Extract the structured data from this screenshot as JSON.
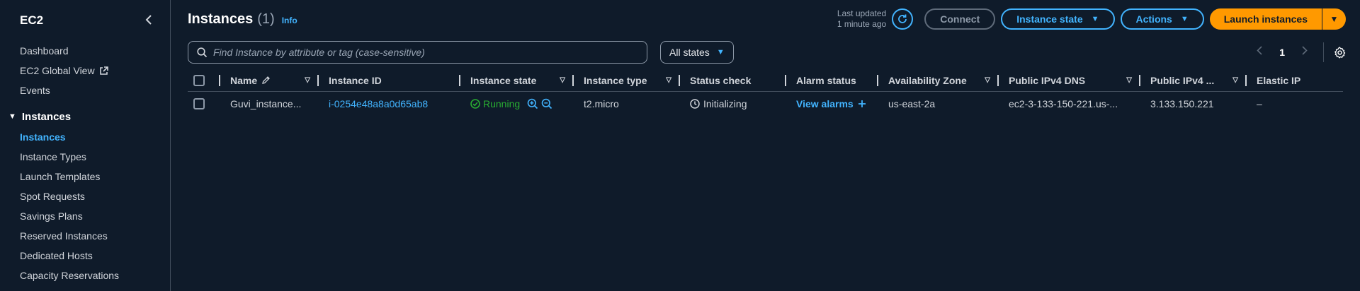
{
  "sidebar": {
    "title": "EC2",
    "items_top": [
      {
        "label": "Dashboard"
      },
      {
        "label": "EC2 Global View"
      },
      {
        "label": "Events"
      }
    ],
    "section": "Instances",
    "items_instances": [
      {
        "label": "Instances"
      },
      {
        "label": "Instance Types"
      },
      {
        "label": "Launch Templates"
      },
      {
        "label": "Spot Requests"
      },
      {
        "label": "Savings Plans"
      },
      {
        "label": "Reserved Instances"
      },
      {
        "label": "Dedicated Hosts"
      },
      {
        "label": "Capacity Reservations"
      }
    ]
  },
  "header": {
    "title": "Instances",
    "count": "(1)",
    "info": "Info",
    "last_updated_line1": "Last updated",
    "last_updated_line2": "1 minute ago",
    "connect": "Connect",
    "instance_state": "Instance state",
    "actions": "Actions",
    "launch": "Launch instances"
  },
  "filter": {
    "search_placeholder": "Find Instance by attribute or tag (case-sensitive)",
    "states_value": "All states",
    "page": "1"
  },
  "table": {
    "columns": {
      "name": "Name",
      "id": "Instance ID",
      "state": "Instance state",
      "type": "Instance type",
      "status": "Status check",
      "alarm": "Alarm status",
      "az": "Availability Zone",
      "dns": "Public IPv4 DNS",
      "ip4": "Public IPv4 ...",
      "eip": "Elastic IP"
    },
    "rows": [
      {
        "name": "Guvi_instance...",
        "id": "i-0254e48a8a0d65ab8",
        "state": "Running",
        "type": "t2.micro",
        "status": "Initializing",
        "alarm": "View alarms",
        "az": "us-east-2a",
        "dns": "ec2-3-133-150-221.us-...",
        "ip4": "3.133.150.221",
        "eip": "–"
      }
    ]
  },
  "colors": {
    "background": "#0f1b2a",
    "link": "#42b4ff",
    "primary": "#ff9900",
    "running": "#29ad32",
    "border": "#414d5c"
  }
}
